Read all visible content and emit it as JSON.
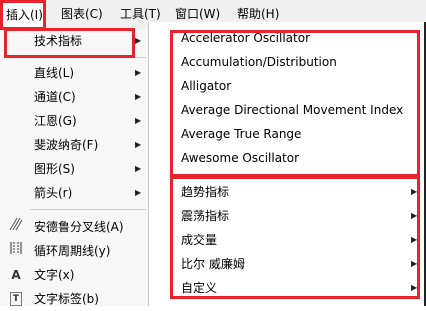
{
  "colors": {
    "highlight": "#e8232b",
    "menubar": "#f0f0f0",
    "menu_bg": "#f7f7f7"
  },
  "menubar": {
    "items": [
      {
        "label": "插入(I)"
      },
      {
        "label": "图表(C)"
      },
      {
        "label": "工具(T)"
      },
      {
        "label": "窗口(W)"
      },
      {
        "label": "帮助(H)"
      }
    ]
  },
  "main_menu": {
    "tech_indicators": "技术指标",
    "items": [
      {
        "label": "直线(L)"
      },
      {
        "label": "通道(C)"
      },
      {
        "label": "江恩(G)"
      },
      {
        "label": "斐波纳奇(F)"
      },
      {
        "label": "图形(S)"
      },
      {
        "label": "箭头(r)"
      }
    ],
    "tools": [
      {
        "label": "安德鲁分叉线(A)",
        "icon": "pitchfork-icon"
      },
      {
        "label": "循环周期线(y)",
        "icon": "cycle-lines-icon"
      },
      {
        "label": "文字(x)",
        "icon": "text-icon",
        "glyph": "A"
      },
      {
        "label": "文字标签(b)",
        "icon": "text-label-icon",
        "glyph": "T"
      }
    ]
  },
  "sub_menu": {
    "indicators": [
      {
        "label": "Accelerator Oscillator"
      },
      {
        "label": "Accumulation/Distribution"
      },
      {
        "label": "Alligator"
      },
      {
        "label": "Average Directional Movement Index"
      },
      {
        "label": "Average True Range"
      },
      {
        "label": "Awesome Oscillator"
      }
    ],
    "categories": [
      {
        "label": "趋势指标"
      },
      {
        "label": "震荡指标"
      },
      {
        "label": "成交量"
      },
      {
        "label": "比尔 威廉姆"
      },
      {
        "label": "自定义"
      }
    ]
  }
}
